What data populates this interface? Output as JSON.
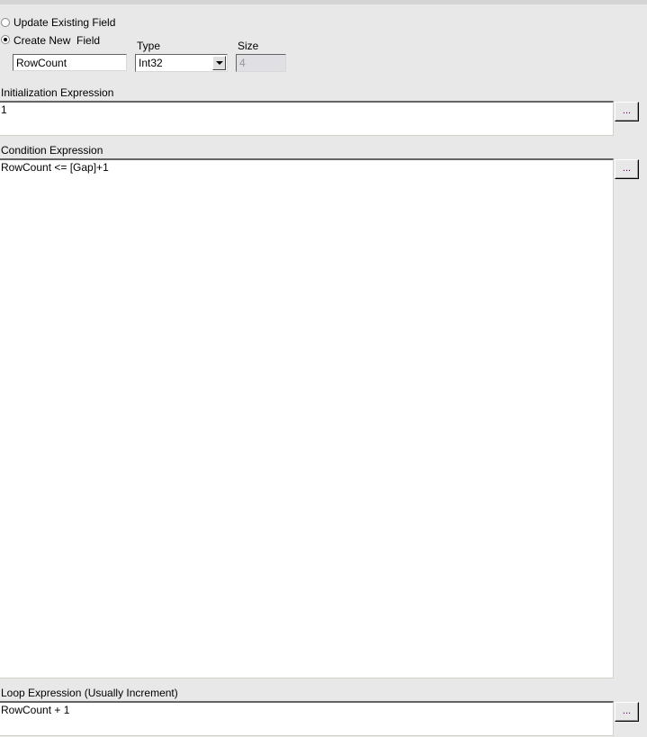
{
  "options": {
    "update_existing": "Update Existing Field",
    "create_new": "Create New  Field",
    "selected": "create_new"
  },
  "field": {
    "name": "RowCount",
    "type_label": "Type",
    "type_value": "Int32",
    "size_label": "Size",
    "size_value": "4"
  },
  "init": {
    "label": "Initialization Expression",
    "value": "1",
    "button": "..."
  },
  "condition": {
    "label": "Condition Expression",
    "value": "RowCount <= [Gap]+1",
    "button": "..."
  },
  "loop": {
    "label": "Loop Expression (Usually Increment)",
    "value": "RowCount + 1",
    "button": "..."
  }
}
